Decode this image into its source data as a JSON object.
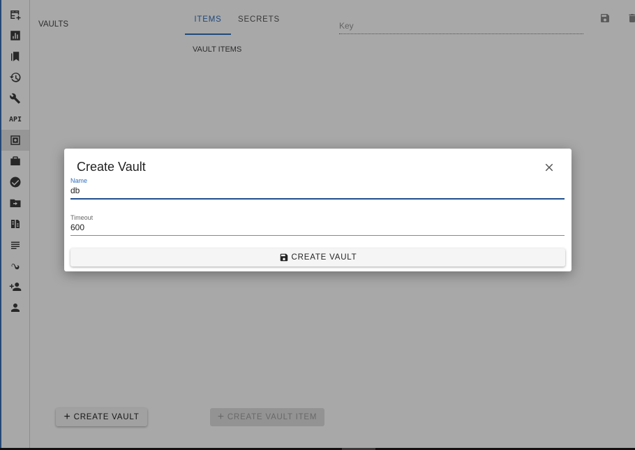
{
  "sidebar": {
    "items": [
      {
        "icon": "table-add-icon"
      },
      {
        "icon": "bar-chart-icon"
      },
      {
        "icon": "bookmarks-icon"
      },
      {
        "icon": "history-icon"
      },
      {
        "icon": "wrench-icon"
      },
      {
        "icon": "api-icon",
        "label": "API"
      },
      {
        "icon": "vault-icon",
        "active": true
      },
      {
        "icon": "briefcase-icon"
      },
      {
        "icon": "check-circle-icon"
      },
      {
        "icon": "folder-move-icon"
      },
      {
        "icon": "document-compare-icon"
      },
      {
        "icon": "notes-lines-icon"
      },
      {
        "icon": "integration-icon"
      },
      {
        "icon": "add-user-icon"
      },
      {
        "icon": "user-icon"
      }
    ]
  },
  "main": {
    "vaults_title": "VAULTS",
    "tabs": [
      {
        "label": "ITEMS",
        "active": true
      },
      {
        "label": "SECRETS",
        "active": false
      }
    ],
    "vault_items_label": "VAULT ITEMS",
    "key_placeholder": "Key",
    "create_vault_label": "CREATE VAULT",
    "create_vault_item_label": "CREATE VAULT ITEM"
  },
  "dialog": {
    "title": "Create Vault",
    "name_label": "Name",
    "name_value": "db",
    "timeout_label": "Timeout",
    "timeout_value": "600",
    "create_button_label": "CREATE VAULT"
  },
  "colors": {
    "accent": "#2f6fbd",
    "focus_underline": "#1f4f8f",
    "overlay": "rgba(0,0,0,0.34)"
  }
}
